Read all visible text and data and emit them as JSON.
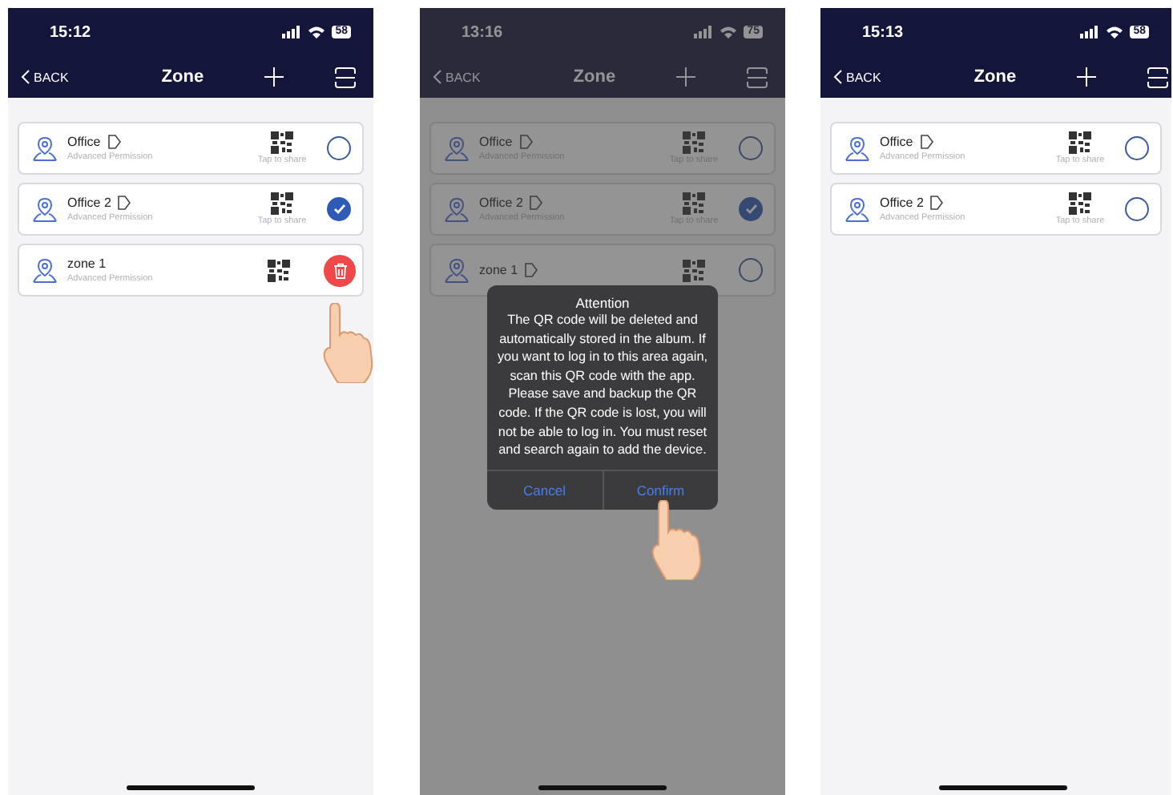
{
  "screens": [
    {
      "status_bar": {
        "time": "15:12",
        "battery": "58"
      },
      "nav": {
        "back": "BACK",
        "title": "Zone"
      },
      "zones": [
        {
          "name": "Office",
          "editable": true,
          "subtitle": "Advanced Permission",
          "share_hint": "Tap to share",
          "kind": "radio",
          "checked": false,
          "touched": false
        },
        {
          "name": "Office 2",
          "editable": true,
          "subtitle": "Advanced Permission",
          "share_hint": "Tap to share",
          "kind": "radio",
          "checked": true,
          "touched": false
        },
        {
          "name": "zone 1",
          "editable": false,
          "subtitle": "Advanced Permission",
          "kind": "delete",
          "touched": true
        }
      ]
    },
    {
      "status_bar": {
        "time": "13:16",
        "battery": "75"
      },
      "nav": {
        "back": "BACK",
        "title": "Zone"
      },
      "zones": [
        {
          "name": "Office",
          "editable": true,
          "subtitle": "Advanced Permission",
          "share_hint": "Tap to share",
          "kind": "radio",
          "checked": false,
          "touched": false
        },
        {
          "name": "Office 2",
          "editable": true,
          "subtitle": "Advanced Permission",
          "share_hint": "Tap to share",
          "kind": "radio",
          "checked": true,
          "touched": false
        },
        {
          "name": "zone 1",
          "editable": true,
          "kind": "radio",
          "checked": false,
          "touched": false
        }
      ],
      "dialog": {
        "title": "Attention",
        "message": "The QR code will be deleted and automatically stored in the album. If you want to log in to this area again, scan this QR code with the app. Please save and backup the QR code. If the QR code is lost, you will not be able to log in. You must reset and search again to add the device.",
        "buttons": [
          {
            "label": "Cancel",
            "touched": false
          },
          {
            "label": "Confirm",
            "touched": true
          }
        ]
      }
    },
    {
      "status_bar": {
        "time": "15:13",
        "battery": "58"
      },
      "nav": {
        "back": "BACK",
        "title": "Zone"
      },
      "zones": [
        {
          "name": "Office",
          "editable": true,
          "subtitle": "Advanced Permission",
          "share_hint": "Tap to share",
          "kind": "radio",
          "checked": false,
          "touched": false
        },
        {
          "name": "Office 2",
          "editable": true,
          "subtitle": "Advanced Permission",
          "share_hint": "Tap to share",
          "kind": "radio",
          "checked": false,
          "touched": false
        }
      ]
    }
  ]
}
